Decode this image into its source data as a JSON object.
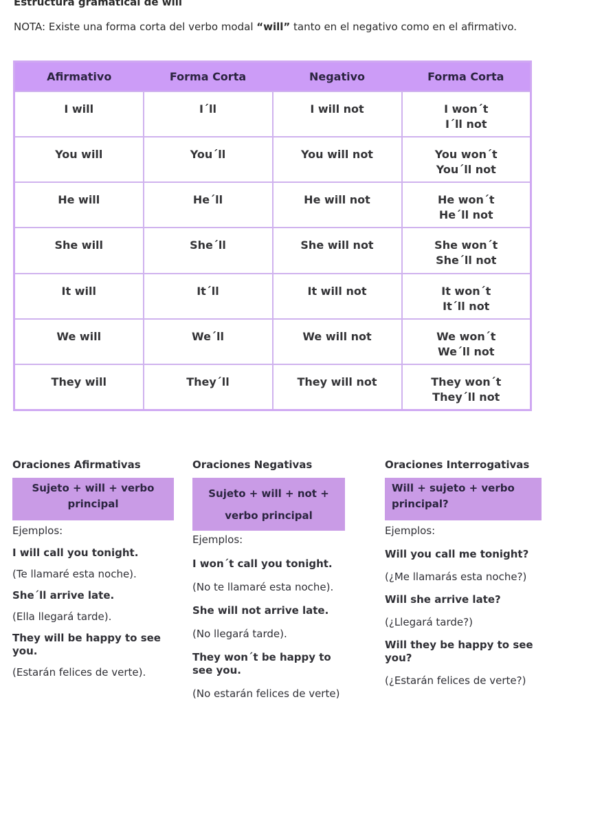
{
  "document": {
    "title": "Estructura gramatical de will",
    "note_prefix": "NOTA: Existe una forma corta del verbo modal ",
    "note_bold": "“will”",
    "note_suffix": " tanto en el negativo como en el afirmativo."
  },
  "colors": {
    "header_purple": "#cc9cf7",
    "formula_purple": "#c99be6",
    "border_lilac": "#cfb2ee"
  },
  "table": {
    "headers": [
      "Afirmativo",
      "Forma Corta",
      "Negativo",
      "Forma Corta"
    ],
    "rows": [
      {
        "affirmative": "I will",
        "short_aff": "I´ll",
        "negative": "I will not",
        "short_neg_1": "I won´t",
        "short_neg_2": "I´ll not"
      },
      {
        "affirmative": "You will",
        "short_aff": "You´ll",
        "negative": "You will not",
        "short_neg_1": "You won´t",
        "short_neg_2": "You´ll not"
      },
      {
        "affirmative": "He will",
        "short_aff": "He´ll",
        "negative": "He will not",
        "short_neg_1": "He won´t",
        "short_neg_2": "He´ll not"
      },
      {
        "affirmative": "She will",
        "short_aff": "She´ll",
        "negative": "She will not",
        "short_neg_1": "She won´t",
        "short_neg_2": "She´ll not"
      },
      {
        "affirmative": "It will",
        "short_aff": "It´ll",
        "negative": "It will not",
        "short_neg_1": "It won´t",
        "short_neg_2": "It´ll not"
      },
      {
        "affirmative": "We will",
        "short_aff": "We´ll",
        "negative": "We will not",
        "short_neg_1": "We won´t",
        "short_neg_2": "We´ll not"
      },
      {
        "affirmative": "They will",
        "short_aff": "They´ll",
        "negative": "They will not",
        "short_neg_1": "They won´t",
        "short_neg_2": "They´ll not"
      }
    ]
  },
  "sections": {
    "affirmative": {
      "title": "Oraciones Afirmativas",
      "formula": "Sujeto + will + verbo principal",
      "examples_label": "Ejemplos:",
      "examples": [
        {
          "en": "I will call you tonight.",
          "es": "(Te llamaré esta noche)."
        },
        {
          "en": "She´ll arrive late.",
          "es": "(Ella llegará tarde)."
        },
        {
          "en": "They will be happy to see you.",
          "es": "(Estarán felices de verte)."
        }
      ]
    },
    "negative": {
      "title": "Oraciones Negativas",
      "formula": "Sujeto + will + not + verbo principal",
      "examples_label": "Ejemplos:",
      "examples": [
        {
          "en": "I won´t call you tonight.",
          "es": "(No te llamaré esta noche)."
        },
        {
          "en": "She will not arrive late.",
          "es": "(No llegará tarde)."
        },
        {
          "en": "They won´t be happy to see you.",
          "es": "(No estarán felices de verte)"
        }
      ]
    },
    "interrogative": {
      "title": "Oraciones Interrogativas",
      "formula": "Will + sujeto + verbo principal?",
      "examples_label": "Ejemplos:",
      "examples": [
        {
          "en": "Will you call me tonight?",
          "es": "(¿Me llamarás esta noche?)"
        },
        {
          "en": "Will she arrive late?",
          "es": "(¿Llegará tarde?)"
        },
        {
          "en": "Will they be happy to see you?",
          "es": "(¿Estarán felices de verte?)"
        }
      ]
    }
  }
}
